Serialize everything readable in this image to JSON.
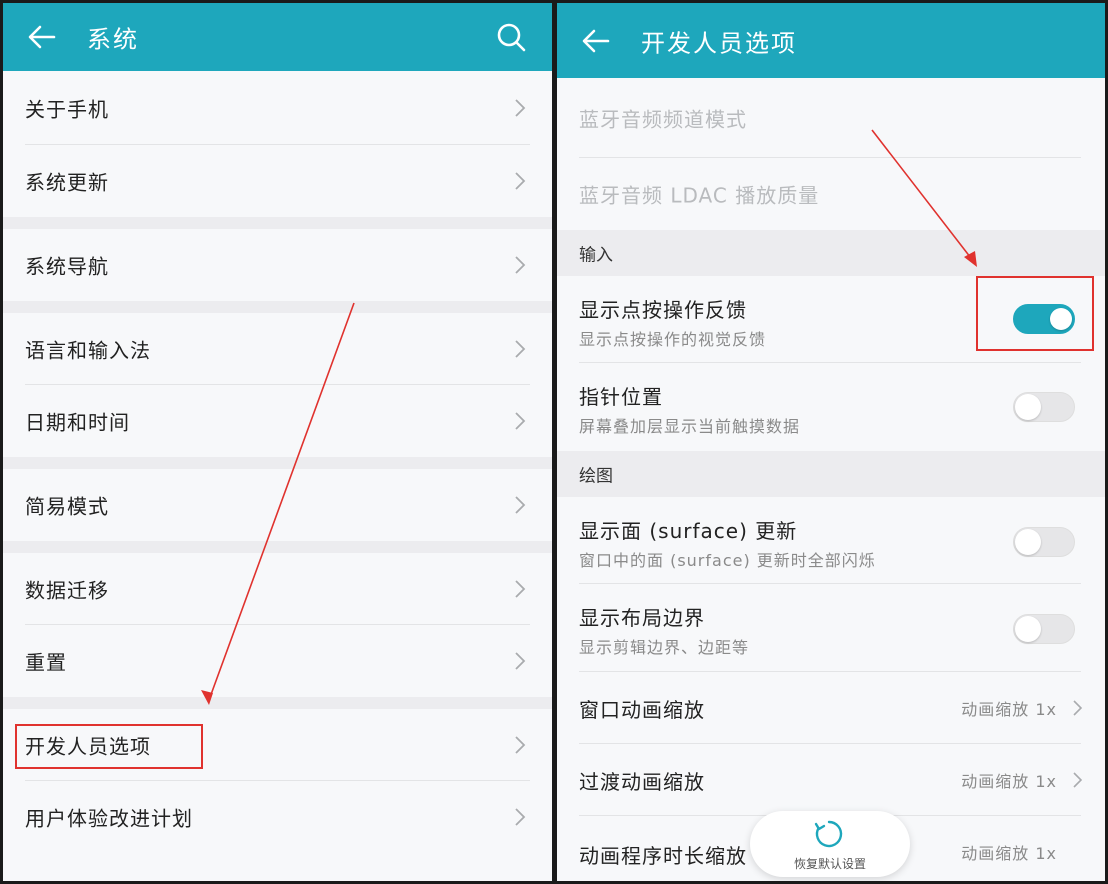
{
  "left_screen": {
    "title": "系统",
    "items": [
      {
        "label": "关于手机"
      },
      {
        "label": "系统更新"
      },
      {
        "label": "系统导航"
      },
      {
        "label": "语言和输入法"
      },
      {
        "label": "日期和时间"
      },
      {
        "label": "简易模式"
      },
      {
        "label": "数据迁移"
      },
      {
        "label": "重置"
      },
      {
        "label": "开发人员选项"
      },
      {
        "label": "用户体验改进计划"
      }
    ]
  },
  "right_screen": {
    "title": "开发人员选项",
    "disabled_items": [
      "蓝牙音频频道模式",
      "蓝牙音频 LDAC 播放质量"
    ],
    "sections": {
      "input": "输入",
      "drawing": "绘图"
    },
    "toggles": [
      {
        "title": "显示点按操作反馈",
        "subtitle": "显示点按操作的视觉反馈",
        "on": true
      },
      {
        "title": "指针位置",
        "subtitle": "屏幕叠加层显示当前触摸数据",
        "on": false
      },
      {
        "title": "显示面 (surface) 更新",
        "subtitle": "窗口中的面 (surface) 更新时全部闪烁",
        "on": false
      },
      {
        "title": "显示布局边界",
        "subtitle": "显示剪辑边界、边距等",
        "on": false
      }
    ],
    "value_rows": [
      {
        "title": "窗口动画缩放",
        "value": "动画缩放 1x"
      },
      {
        "title": "过渡动画缩放",
        "value": "动画缩放 1x"
      },
      {
        "title": "动画程序时长缩放",
        "value": "动画缩放 1x"
      }
    ],
    "fab_label": "恢复默认设置"
  },
  "colors": {
    "header": "#1ea7bc",
    "toggle_on": "#1ea7bc",
    "annotation": "#e0322e"
  }
}
